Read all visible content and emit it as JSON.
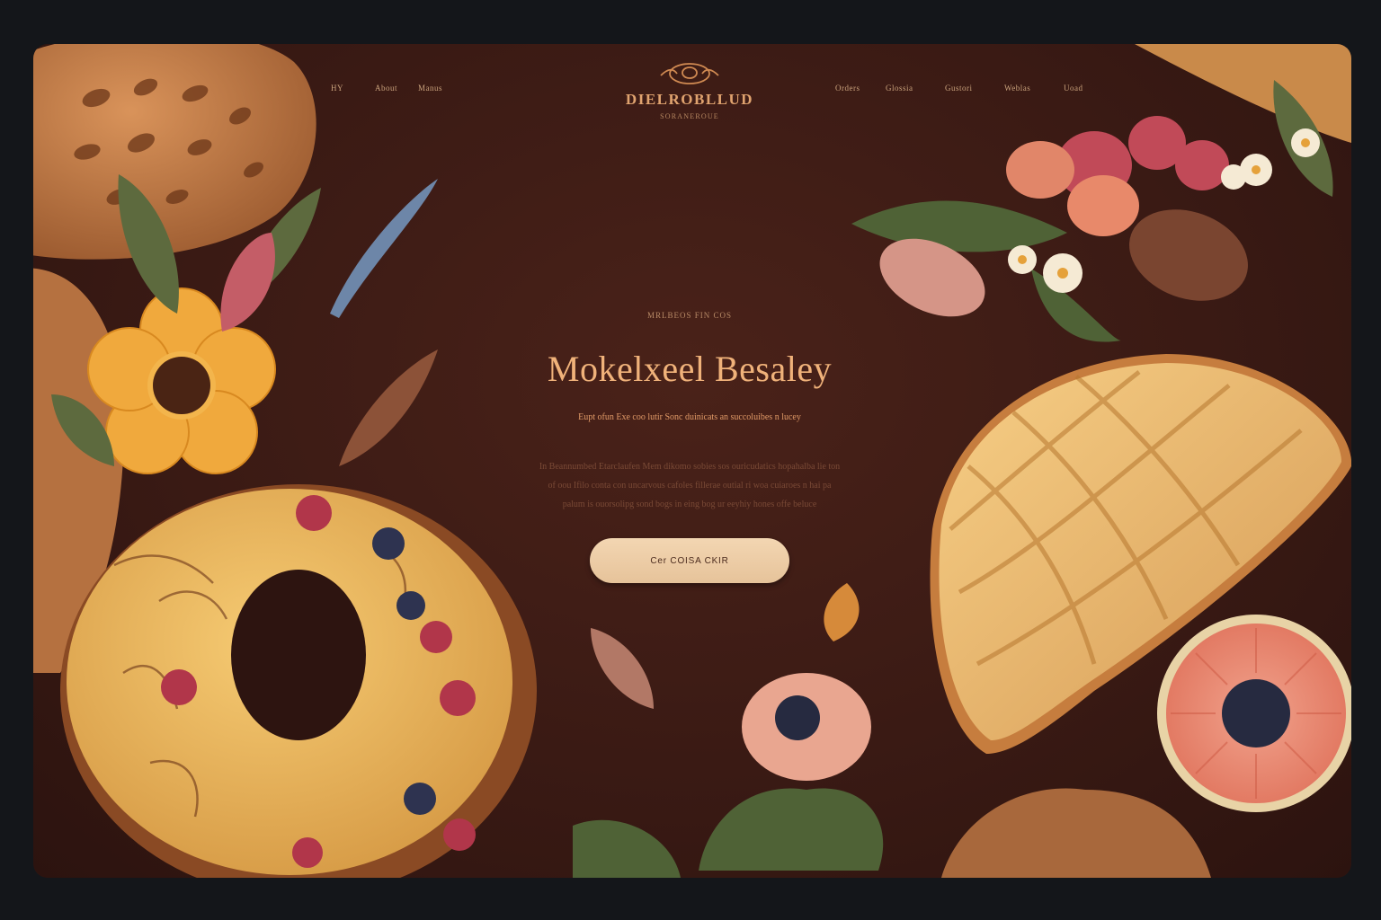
{
  "brand": {
    "name": "DIELROBLLUD",
    "tagline": "SORANEROUE"
  },
  "nav_left": [
    "HY",
    "About",
    "Manus"
  ],
  "nav_right": [
    "Orders",
    "Glossia",
    "Gustori",
    "Weblas",
    "Uoad"
  ],
  "hero": {
    "eyebrow": "MRLBEOS  FIN  COS",
    "title": "Mokelxeel Besaley",
    "subtitle": "Eupt ofun Exe coo lutir Sonc duinicats an succoluibes n lucey",
    "body_lines": [
      "In Beannumbed Etarclaufen Mem dikomo sobies sos ouricudatics hopahalba lie ton",
      "of oou Ifilo conta con uncarvous cafoles fillerae outial ri woa cuiaroes n hai pa",
      "palum is ouorsolipg sond bogs in eing bog ur eeyhiy hones offe beluce"
    ],
    "cta_label": "Cer COISA CKIR"
  },
  "colors": {
    "background": "#3a1a14",
    "page_backdrop": "#14161a",
    "accent": "#f0b27a",
    "button": "#ecd0ac"
  },
  "icons": [
    "croissant-logo-icon"
  ]
}
